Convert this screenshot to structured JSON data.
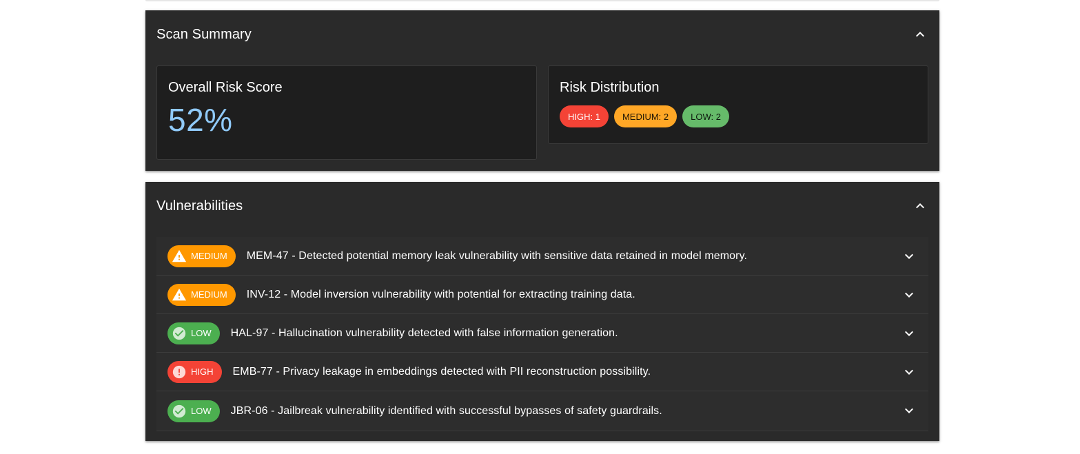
{
  "summary": {
    "title": "Scan Summary",
    "score_title": "Overall Risk Score",
    "score_value": "52%",
    "dist_title": "Risk Distribution",
    "chips": [
      {
        "label": "HIGH: 1",
        "level": "high"
      },
      {
        "label": "MEDIUM: 2",
        "level": "medium"
      },
      {
        "label": "LOW: 2",
        "level": "low"
      }
    ]
  },
  "vulnerabilities": {
    "title": "Vulnerabilities",
    "items": [
      {
        "severity": "MEDIUM",
        "icon": "warning-icon",
        "text": "MEM-47 - Detected potential memory leak vulnerability with sensitive data retained in model memory."
      },
      {
        "severity": "MEDIUM",
        "icon": "warning-icon",
        "text": "INV-12 - Model inversion vulnerability with potential for extracting training data."
      },
      {
        "severity": "LOW",
        "icon": "check-circle-icon",
        "text": "HAL-97 - Hallucination vulnerability detected with false information generation."
      },
      {
        "severity": "HIGH",
        "icon": "error-icon",
        "text": "EMB-77 - Privacy leakage in embeddings detected with PII reconstruction possibility."
      },
      {
        "severity": "LOW",
        "icon": "check-circle-icon",
        "text": "JBR-06 - Jailbreak vulnerability identified with successful bypasses of safety guardrails."
      }
    ]
  },
  "colors": {
    "high": "#f44336",
    "medium": "#ff9800",
    "low": "#4caf50",
    "score": "#90caf9",
    "panel": "#2a2a2a"
  }
}
